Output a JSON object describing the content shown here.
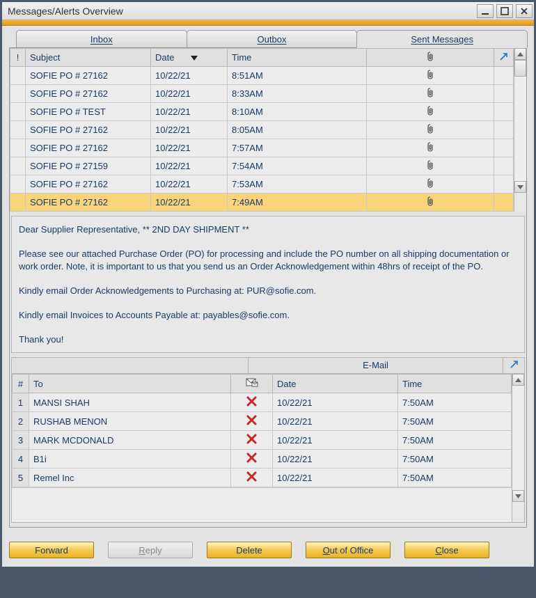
{
  "window": {
    "title": "Messages/Alerts Overview"
  },
  "tabs": {
    "inbox": "Inbox",
    "outbox": "Outbox",
    "sent": "Sent Messages"
  },
  "columns": {
    "bang": "!",
    "subject": "Subject",
    "date": "Date",
    "time": "Time"
  },
  "messages": [
    {
      "subject": "SOFIE PO # 27162",
      "date": "10/22/21",
      "time": "8:51AM",
      "selected": false
    },
    {
      "subject": "SOFIE PO # 27162",
      "date": "10/22/21",
      "time": "8:33AM",
      "selected": false
    },
    {
      "subject": "SOFIE PO # TEST",
      "date": "10/22/21",
      "time": "8:10AM",
      "selected": false
    },
    {
      "subject": "SOFIE PO # 27162",
      "date": "10/22/21",
      "time": "8:05AM",
      "selected": false
    },
    {
      "subject": "SOFIE PO # 27162",
      "date": "10/22/21",
      "time": "7:57AM",
      "selected": false
    },
    {
      "subject": "SOFIE PO # 27159",
      "date": "10/22/21",
      "time": "7:54AM",
      "selected": false
    },
    {
      "subject": "SOFIE PO # 27162",
      "date": "10/22/21",
      "time": "7:53AM",
      "selected": false
    },
    {
      "subject": "SOFIE PO # 27162",
      "date": "10/22/21",
      "time": "7:49AM",
      "selected": true
    }
  ],
  "preview": {
    "line1": "Dear Supplier Representative,  ** 2ND DAY SHIPMENT **",
    "line2": "Please see our attached Purchase Order (PO) for processing and include the PO number on all shipping documentation or work order.  Note, it is important to us that you send us an Order Acknowledgement within 48hrs of receipt of the PO.",
    "line3": "Kindly email Order Acknowledgements to Purchasing at:  PUR@sofie.com.",
    "line4": "Kindly email Invoices to Accounts Payable at:  payables@sofie.com.",
    "line5": "Thank you!"
  },
  "recipients_section_label": "E-Mail",
  "recip_columns": {
    "num": "#",
    "to": "To",
    "date": "Date",
    "time": "Time"
  },
  "recipients": [
    {
      "n": "1",
      "to": "MANSI SHAH",
      "date": "10/22/21",
      "time": "7:50AM"
    },
    {
      "n": "2",
      "to": "RUSHAB MENON",
      "date": "10/22/21",
      "time": "7:50AM"
    },
    {
      "n": "3",
      "to": "MARK MCDONALD",
      "date": "10/22/21",
      "time": "7:50AM"
    },
    {
      "n": "4",
      "to": "B1i",
      "date": "10/22/21",
      "time": "7:50AM"
    },
    {
      "n": "5",
      "to": "Remel Inc",
      "date": "10/22/21",
      "time": "7:50AM"
    }
  ],
  "buttons": {
    "forward": "Forward",
    "reply": "Reply",
    "delete": "Delete",
    "out_of_office": "Out of Office",
    "close": "Close"
  }
}
